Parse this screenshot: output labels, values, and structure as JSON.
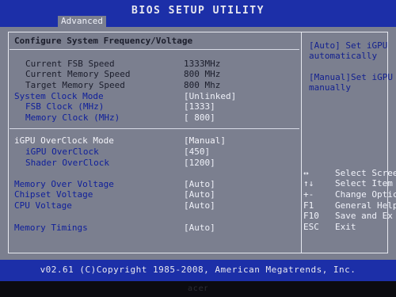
{
  "header": {
    "title": "BIOS SETUP UTILITY",
    "active_tab": "Advanced"
  },
  "section_title": "Configure System Frequency/Voltage",
  "info": [
    {
      "label": "Current FSB Speed",
      "value": "1333MHz"
    },
    {
      "label": "Current Memory Speed",
      "value": "800 MHz"
    },
    {
      "label": "Target Memory Speed",
      "value": "800 Mhz"
    }
  ],
  "clock": {
    "mode_label": "System Clock Mode",
    "mode_value": "[Unlinked]",
    "fsb_label": "FSB Clock (MHz)",
    "fsb_value": "[1333]",
    "mem_label": "Memory Clock (MHz)",
    "mem_value": "[ 800]"
  },
  "igpu": {
    "mode_label": "iGPU OverClock Mode",
    "mode_value": "[Manual]",
    "oc_label": "iGPU OverClock",
    "oc_value": "[450]",
    "shader_label": "Shader OverClock",
    "shader_value": "[1200]"
  },
  "voltage": [
    {
      "label": "Memory Over Voltage",
      "value": "[Auto]"
    },
    {
      "label": "Chipset Voltage",
      "value": "[Auto]"
    },
    {
      "label": "CPU Voltage",
      "value": "[Auto]"
    }
  ],
  "timings": {
    "label": "Memory Timings",
    "value": "[Auto]"
  },
  "help": {
    "line1": "[Auto] Set iGPU",
    "line2": "automatically",
    "line3": "[Manual]Set iGPU",
    "line4": "manually"
  },
  "keys": [
    {
      "key": "↔",
      "desc": "Select Scree"
    },
    {
      "key": "↑↓",
      "desc": "Select Item"
    },
    {
      "key": "+-",
      "desc": "Change Optic"
    },
    {
      "key": "F1",
      "desc": "General Help"
    },
    {
      "key": "F10",
      "desc": "Save and Ex"
    },
    {
      "key": "ESC",
      "desc": "Exit"
    }
  ],
  "footer": {
    "copyright": "v02.61 (C)Copyright 1985-2008, American Megatrends, Inc."
  },
  "bezel": {
    "brand": "acer"
  }
}
